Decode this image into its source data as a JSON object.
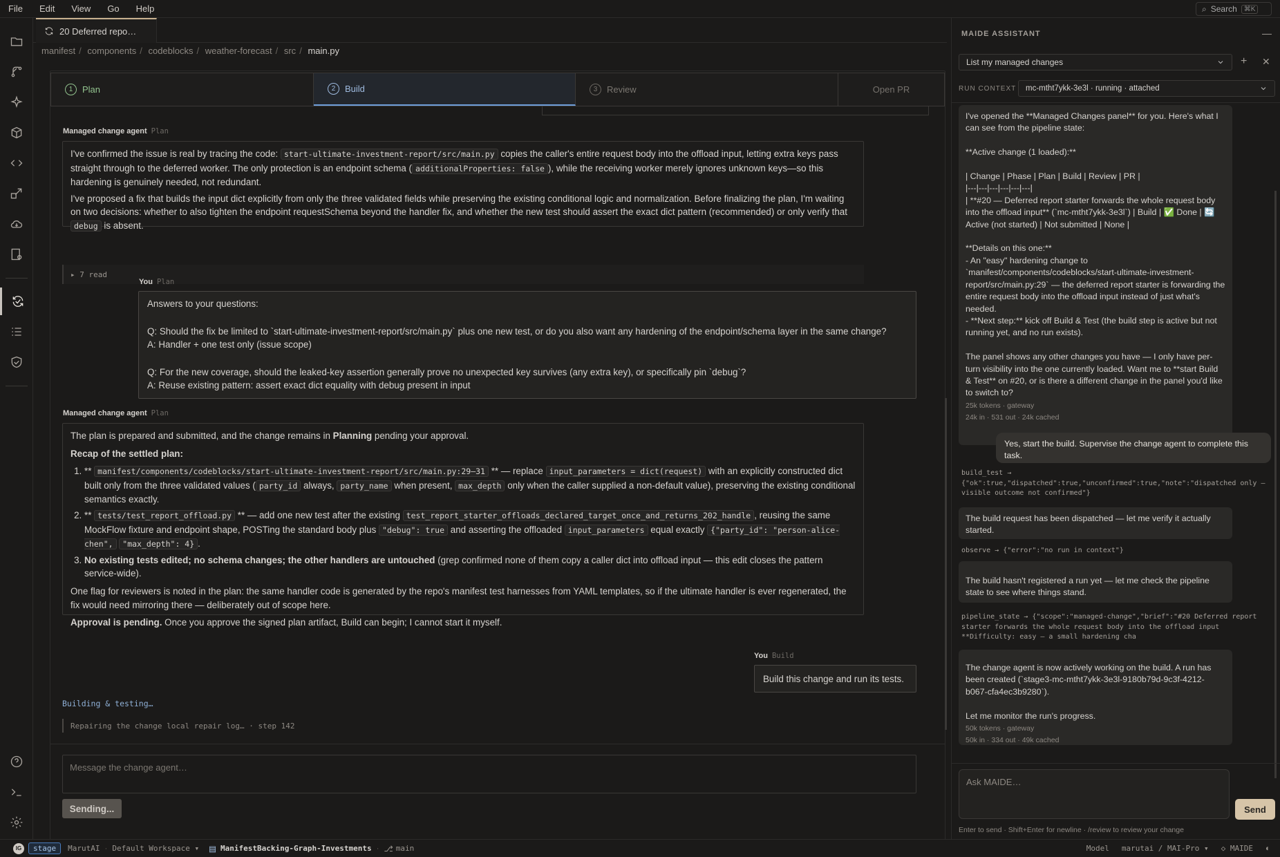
{
  "menu": [
    "File",
    "Edit",
    "View",
    "Go",
    "Help"
  ],
  "top_search": {
    "label": "Search",
    "shortcut": "⌘K"
  },
  "tab": {
    "label": "20 Deferred repo…"
  },
  "breadcrumb": [
    "manifest",
    "components",
    "codeblocks",
    "weather-forecast",
    "src",
    "main.py"
  ],
  "stepper": {
    "plan": {
      "num": "1",
      "label": "Plan"
    },
    "build": {
      "num": "2",
      "label": "Build"
    },
    "review": {
      "num": "3",
      "label": "Review"
    },
    "open_pr": "Open PR"
  },
  "conversation": {
    "msg1": {
      "author": "Managed change agent",
      "phase": "Plan",
      "p1_a": "I've confirmed the issue is real by tracing the code: ",
      "p1_code1": "start-ultimate-investment-report/src/main.py",
      "p1_b": " copies the caller's entire request body into the offload input, letting extra keys pass straight through to the deferred worker. The only protection is an endpoint schema (",
      "p1_code2": "additionalProperties: false",
      "p1_c": "), while the receiving worker merely ignores unknown keys—so this hardening is genuinely needed, not redundant.",
      "p2_a": "I've proposed a fix that builds the input dict explicitly from only the three validated fields while preserving the existing conditional logic and normalization. Before finalizing the plan, I'm waiting on two decisions: whether to also tighten the endpoint requestSchema beyond the handler fix, and whether the new test should assert the exact dict pattern (recommended) or only verify that ",
      "p2_code": "debug",
      "p2_b": " is absent."
    },
    "read_summary": "▸ 7 read",
    "user1": {
      "author": "You",
      "phase": "Plan",
      "l1": "Answers to your questions:",
      "l2": "Q: Should the fix be limited to `start-ultimate-investment-report/src/main.py` plus one new test, or do you also want any hardening of the endpoint/schema layer in the same change?",
      "l3": "A: Handler + one test only (issue scope)",
      "l4": "Q: For the new coverage, should the leaked-key assertion generally prove no unexpected key survives (any extra key), or specifically pin `debug`?",
      "l5": "A: Reuse existing pattern: assert exact dict equality with debug present in input"
    },
    "msg2": {
      "author": "Managed change agent",
      "phase": "Plan",
      "p1_a": "The plan is prepared and submitted, and the change remains in ",
      "p1_b": "Planning",
      "p1_c": " pending your approval.",
      "recap": "Recap of the settled plan:",
      "i1_a": "** ",
      "i1_code": "manifest/components/codeblocks/start-ultimate-investment-report/src/main.py:29–31",
      "i1_b": " ** — replace ",
      "i1_code2": "input_parameters = dict(request)",
      "i1_c": " with an explicitly constructed dict built only from the three validated values (",
      "i1_code3": "party_id",
      "i1_d": " always, ",
      "i1_code4": "party_name",
      "i1_e": " when present, ",
      "i1_code5": "max_depth",
      "i1_f": " only when the caller supplied a non-default value), preserving the existing conditional semantics exactly.",
      "i2_a": "** ",
      "i2_code": "tests/test_report_offload.py",
      "i2_b": " ** — add one new test after the existing ",
      "i2_code2": "test_report_starter_offloads_declared_target_once_and_returns_202_handle",
      "i2_c": ", reusing the same MockFlow fixture and endpoint shape, POSTing the standard body plus ",
      "i2_code3": "\"debug\": true",
      "i2_d": " and asserting the offloaded ",
      "i2_code4": "input_parameters",
      "i2_e": " equal exactly ",
      "i2_code5": "{\"party_id\": \"person-alice-chen\",",
      "i2_code6": "\"max_depth\": 4}",
      "i2_f": ".",
      "i3_a": "No existing tests edited; no schema changes; the other handlers are untouched",
      "i3_b": " (grep confirmed none of them copy a caller dict into offload input — this edit closes the pattern service-wide).",
      "flag": "One flag for reviewers is noted in the plan: the same handler code is generated by the repo's manifest test harnesses from YAML templates, so if the ultimate handler is ever regenerated, the fix would need mirroring there — deliberately out of scope here.",
      "appr_a": "Approval is pending.",
      "appr_b": " Once you approve the signed plan artifact, Build can begin; I cannot start it myself."
    },
    "user2": {
      "author": "You",
      "phase": "Build",
      "text": "Build this change and run its tests."
    },
    "building": "Building & testing…",
    "repair": "Repairing the change local repair log… · step 142"
  },
  "composer": {
    "placeholder": "Message the change agent…",
    "button": "Sending..."
  },
  "assistant": {
    "title": "MAIDE ASSISTANT",
    "selector": "List my managed changes",
    "run_context_label": "RUN CONTEXT",
    "run_context": "mc-mtht7ykk-3e3l · running · attached",
    "b1_text": "I've opened the **Managed Changes panel** for you. Here's what I can see from the pipeline state:\n\n**Active change (1 loaded):**\n\n| Change | Phase | Plan | Build | Review | PR |\n|---|---|---|---|---|---|\n| **#20 — Deferred report starter forwards the whole request body into the offload input** (`mc-mtht7ykk-3e3l`) | Build | ✅ Done | 🔄 Active (not started) | Not submitted | None |\n\n**Details on this one:**\n- An \"easy\" hardening change to `manifest/components/codeblocks/start-ultimate-investment-report/src/main.py:29` — the deferred report starter is forwarding the entire request body into the offload input instead of just what's needed.\n- **Next step:** kick off Build & Test (the build step is active but not running yet, and no run exists).\n\nThe panel shows any other changes you have — I only have per-turn visibility into the one currently loaded. Want me to **start Build & Test** on #20, or is there a different change in the panel you'd like to switch to?",
    "b1_meta1": "25k tokens · gateway",
    "b1_meta2": "24k in · 531 out · 24k cached",
    "u1": "Yes, start the build. Supervise the change agent to complete this task.",
    "t1": "build_test →\n{\"ok\":true,\"dispatched\":true,\"unconfirmed\":true,\"note\":\"dispatched only — visible outcome not confirmed\"}",
    "b2": "The build request has been dispatched — let me verify it actually started.",
    "t2": "observe → {\"error\":\"no run in context\"}",
    "b3": "The build hasn't registered a run yet — let me check the pipeline state to see where things stand.",
    "t3": "pipeline_state → {\"scope\":\"managed-change\",\"brief\":\"#20 Deferred report starter forwards the whole request body into the offload input **Difficulty: easy — a small hardening cha",
    "b4": "The change agent is now actively working on the build. A run has been created (`stage3-mc-mtht7ykk-3e3l-9180b79d-9c3f-4212-b067-cfa4ec3b9280`).\n\nLet me monitor the run's progress.",
    "b4_meta1": "50k tokens · gateway",
    "b4_meta2": "50k in · 334 out · 49k cached",
    "ask_placeholder": "Ask MAIDE…",
    "send": "Send",
    "hint": "Enter to send · Shift+Enter for newline · /review to review your change"
  },
  "statusbar": {
    "avatar": "IG",
    "stage": "stage",
    "org": "MarutAI",
    "workspace": "Default Workspace ▾",
    "repo": "ManifestBacking-Graph-Investments",
    "branch": "main",
    "model_label": "Model",
    "model": "marutai / MAI-Pro ▾",
    "maide": "MAIDE"
  }
}
